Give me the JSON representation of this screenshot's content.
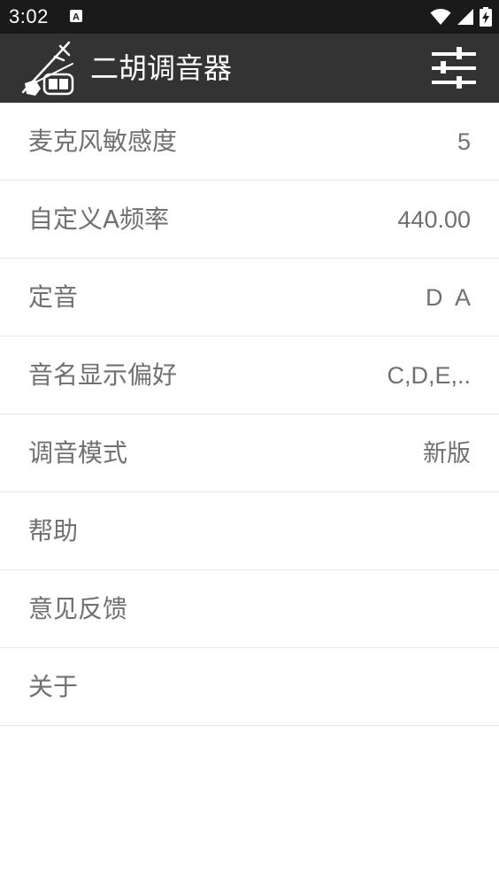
{
  "status_bar": {
    "time": "3:02",
    "icons": [
      "notification-a-icon",
      "wifi-icon",
      "signal-icon",
      "battery-charging-icon"
    ]
  },
  "app_bar": {
    "title": "二胡调音器",
    "icons": [
      "erhu-logo-icon",
      "sliders-settings-icon"
    ]
  },
  "settings": {
    "items": [
      {
        "label": "麦克风敏感度",
        "value": "5"
      },
      {
        "label": "自定义A频率",
        "value": "440.00"
      },
      {
        "label": "定音",
        "value": "D  A"
      },
      {
        "label": "音名显示偏好",
        "value": "C,D,E,.."
      },
      {
        "label": "调音模式",
        "value": "新版"
      },
      {
        "label": "帮助",
        "value": ""
      },
      {
        "label": "意见反馈",
        "value": ""
      },
      {
        "label": "关于",
        "value": ""
      }
    ]
  },
  "colors": {
    "status_bar_bg": "#1a1a1a",
    "app_bar_bg": "#333333",
    "text_gray": "#707070",
    "divider": "#e8e8e8"
  }
}
